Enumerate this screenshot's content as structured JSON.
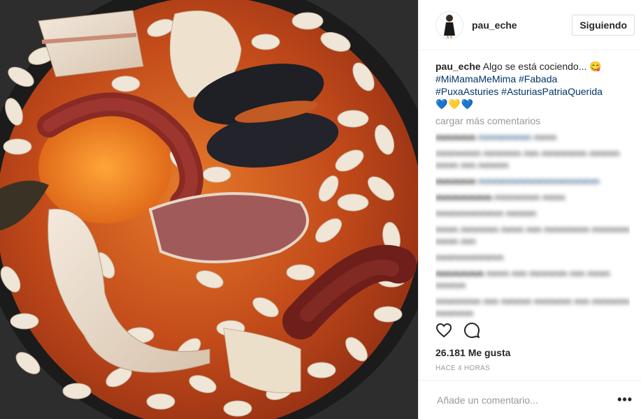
{
  "post": {
    "username": "pau_eche",
    "follow_label": "Siguiendo",
    "caption_user": "pau_eche",
    "caption_text": "Algo se está cociendo... 😋",
    "tags_line1": "#MiMamaMeMima #Fabada",
    "tags_line2": "#PuxaAsturies #AsturiasPatriaQuerida",
    "hearts": "💙💛💙",
    "load_more": "cargar más comentarios",
    "likes": "26.181 Me gusta",
    "time": "HACE 4 HORAS",
    "comment_placeholder": "Añade un comentario...",
    "more_label": "•••"
  },
  "icons": {
    "like": "heart-icon",
    "comment": "comment-bubble-icon",
    "more": "more-options-icon"
  },
  "colors": {
    "hashtag": "#003569",
    "muted": "#999999",
    "text": "#262626"
  }
}
